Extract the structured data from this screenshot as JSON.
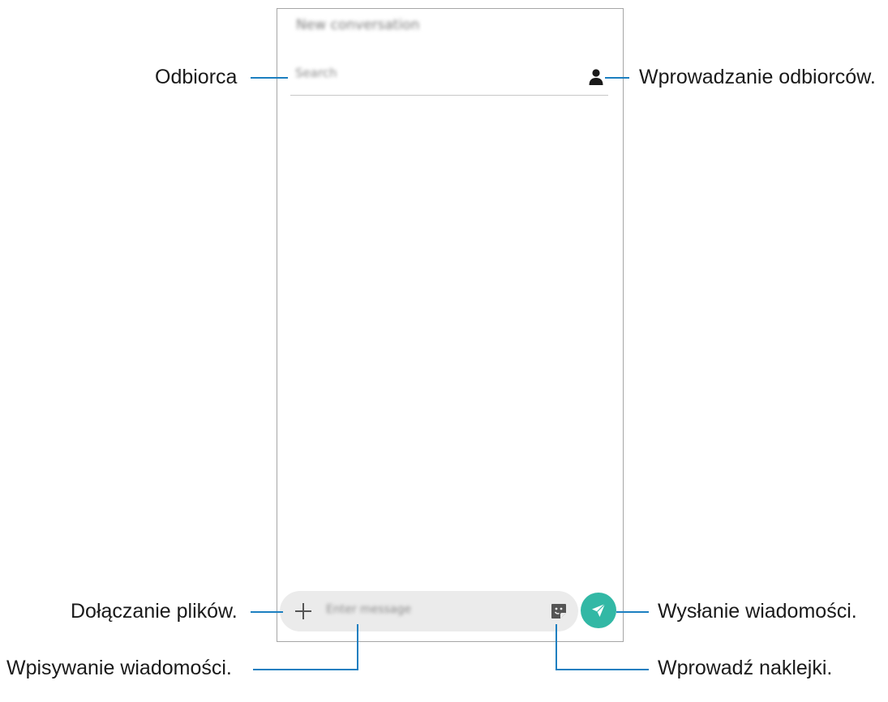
{
  "screen": {
    "title": "New conversation",
    "recipient_placeholder": "Search",
    "message_placeholder": "Enter message"
  },
  "icons": {
    "contact_picker": "person-icon",
    "attach": "plus-icon",
    "sticker": "sticker-icon",
    "send": "send-icon"
  },
  "colors": {
    "send_button": "#32b8a5",
    "leader_line": "#1c7fc0",
    "composer_bg": "#ebebeb"
  },
  "callouts": {
    "recipient": "Odbiorca",
    "enter_recipients": "Wprowadzanie odbiorców.",
    "attach_files": "Dołączanie plików.",
    "send_message": "Wysłanie wiadomości.",
    "enter_message": "Wpisywanie wiadomości.",
    "enter_stickers": "Wprowadź naklejki."
  }
}
